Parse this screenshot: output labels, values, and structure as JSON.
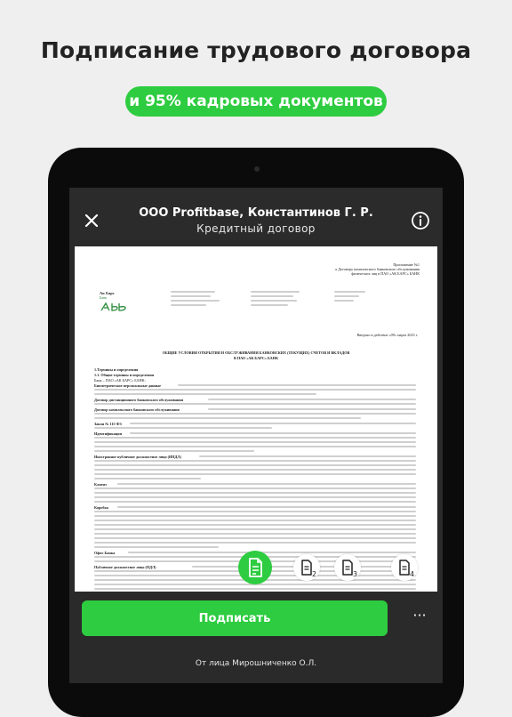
{
  "promo": {
    "headline": "Подписание трудового договора",
    "pill": "и 95% кадровых документов",
    "accent": "#2ecc40"
  },
  "appbar": {
    "title": "ООО Profitbase, Константинов Г. Р.",
    "subtitle": "Кредитный договор",
    "close_icon": "close-icon",
    "info_icon": "info-icon"
  },
  "document": {
    "appendix": "Приложение №1",
    "appendix_2": "к Договору комплексного банковского обслуживания",
    "appendix_3": "физических лиц в ПАО «АК БАРС» БАНК",
    "logo_text": "Ак Барс",
    "logo_sub": "Банк",
    "effective": "Введено в действие «09» марта 2023 г.",
    "heading_1": "ОБЩИЕ УСЛОВИЯ ОТКРЫТИЯ И ОБСЛУЖИВАНИЯ БАНКОВСКИХ (ТЕКУЩИХ) СЧЕТОВ И ВКЛАДОВ",
    "heading_2": "В ПАО «АК БАРС» БАНК",
    "section_1": "1.Термины и определения",
    "section_1_1": "1.1.     Общие термины и определения",
    "bank_def": "Банк – ПАО «АК БАРС» БАНК;",
    "bio_def": "Биометрические персональные данные",
    "remote_def": "Договор дистанционного банковского обслуживания",
    "complex_def": "Договор комплексного банковского обслуживания",
    "law_def": "Закон № 115-ФЗ",
    "ident_def": "Идентификация",
    "foreign_def": "Иностранное публичное должностное лицо (ИПДЛ)",
    "client_def": "Клиент",
    "box_def": "Коробка",
    "office_def": "Офис Банка",
    "public_def": "Публичное должностное лицо (ПДЛ)"
  },
  "fabs": {
    "main_icon": "document-sign-icon",
    "items": [
      {
        "icon": "document-icon",
        "badge": "2"
      },
      {
        "icon": "document-icon",
        "badge": "3"
      },
      {
        "icon": "document-icon",
        "badge": "4"
      }
    ]
  },
  "bottom": {
    "sign_label": "Подписать",
    "more_label": "···",
    "on_behalf": "От лица Мирошниченко О.Л."
  }
}
